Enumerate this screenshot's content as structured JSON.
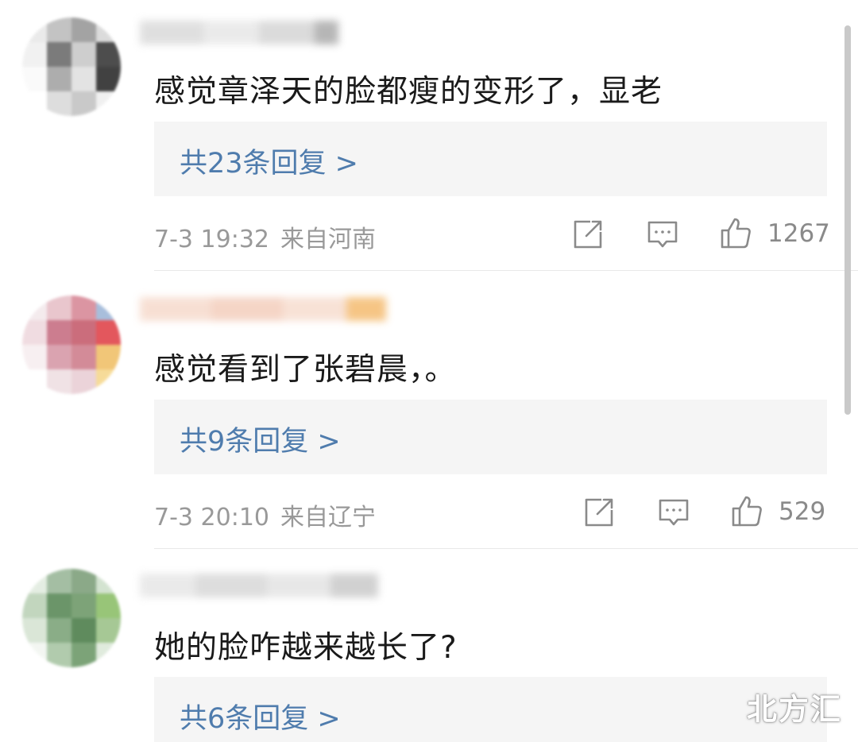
{
  "comments": [
    {
      "text": "感觉章泽天的脸都瘦的变形了，显老",
      "reply_summary": "共23条回复 >",
      "date": "7-3 19:32",
      "location": "来自河南",
      "likes": "1267"
    },
    {
      "text": "感觉看到了张碧晨，。",
      "reply_summary": "共9条回复 >",
      "date": "7-3 20:10",
      "location": "来自辽宁",
      "likes": "529"
    },
    {
      "text": "她的脸咋越来越长了?",
      "reply_summary": "共6条回复 >"
    }
  ],
  "icons": {
    "share": "share-icon",
    "comment": "comment-icon",
    "like": "thumbs-up-icon"
  },
  "watermark": "北方汇",
  "colors": {
    "link": "#4f7cad",
    "reply_bg": "#f5f5f5",
    "meta": "#999999",
    "text": "#1a1a1a"
  }
}
